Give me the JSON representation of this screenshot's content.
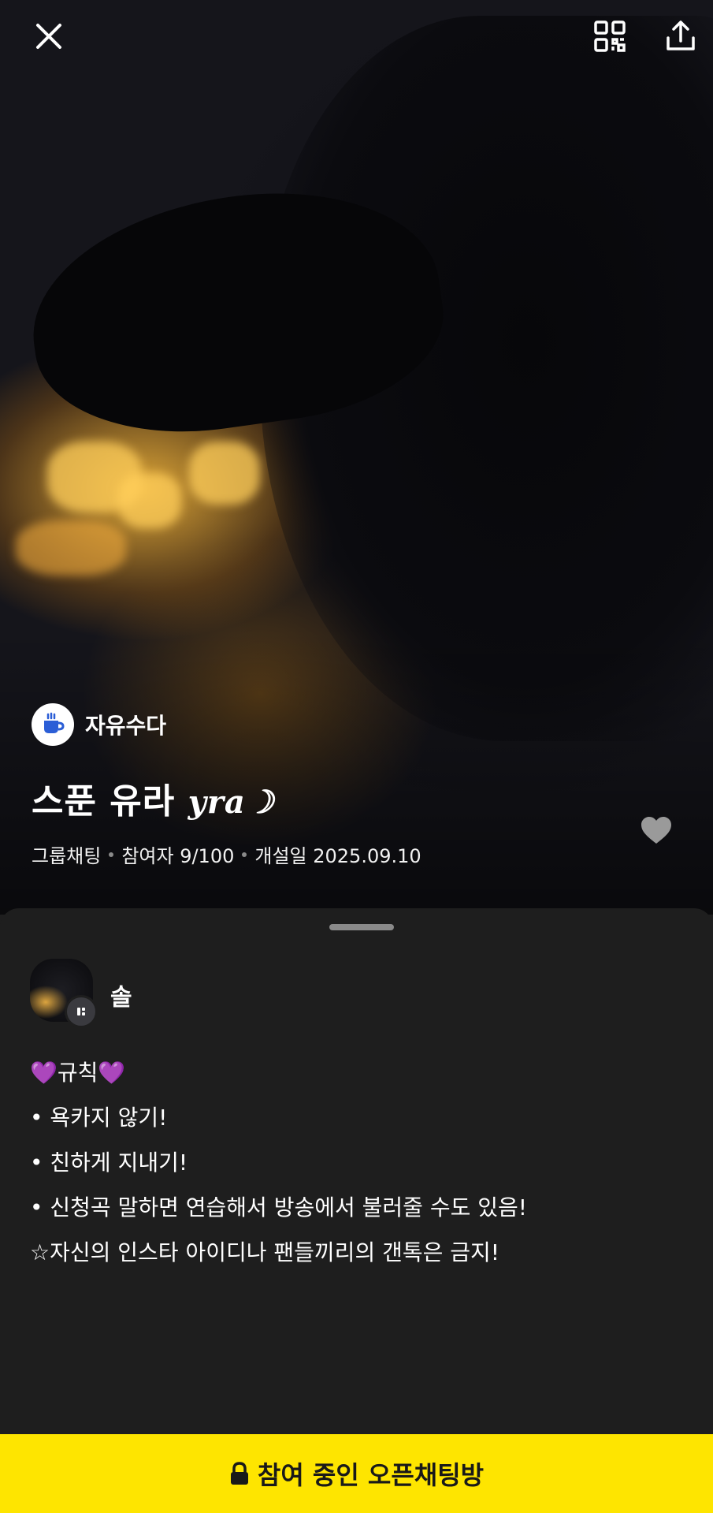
{
  "header": {
    "close_icon": "close-icon",
    "qr_icon": "qr-code-icon",
    "share_icon": "share-icon"
  },
  "room": {
    "category_icon": "coffee-cup-icon",
    "category": "자유수다",
    "title": "스푼 유라",
    "title_script": "yra☽",
    "type": "그룹채팅",
    "participants": "참여자 9/100",
    "created": "개설일 2025.09.10",
    "favorite_icon": "heart-icon"
  },
  "owner": {
    "name": "솔",
    "badge_icon": "host-badge-icon"
  },
  "description": [
    "💜규칙💜",
    "• 욕카지 않기!",
    "• 친하게 지내기!",
    "• 신청곡 말하면 연습해서 방송에서 불러줄 수도 있음!",
    "☆자신의 인스타 아이디나 팬들끼리의 갠톡은 금지!"
  ],
  "join_button": {
    "icon": "lock-icon",
    "label": "참여 중인 오픈채팅방"
  },
  "colors": {
    "accent": "#fee500",
    "sheet": "#1e1e1e",
    "category_icon": "#2b5ed6"
  }
}
